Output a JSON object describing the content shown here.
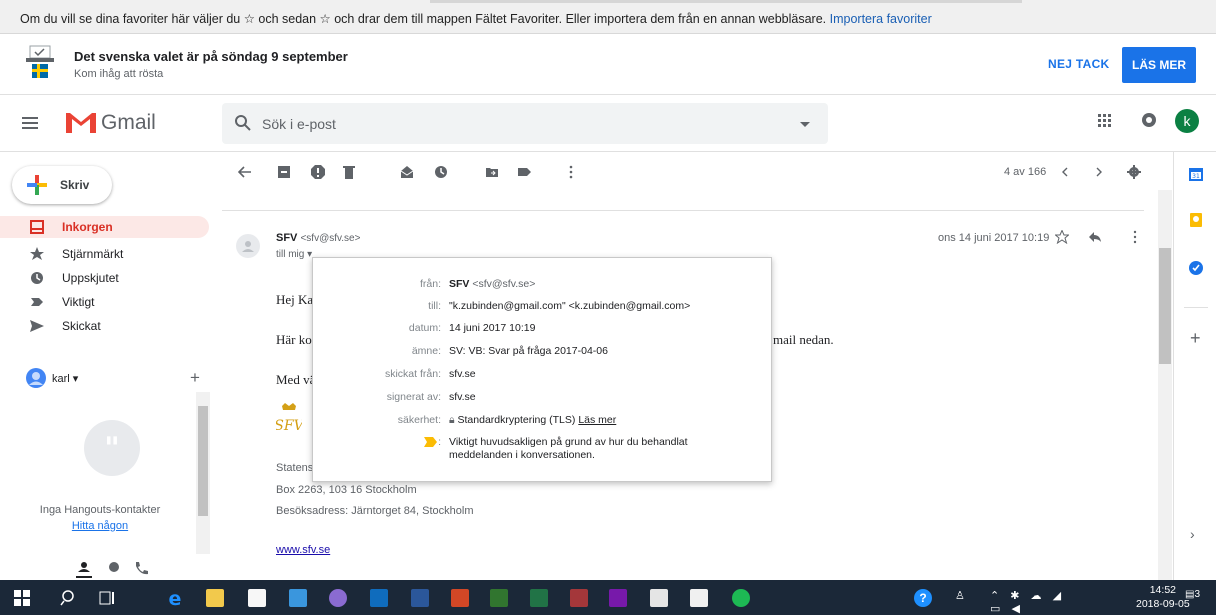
{
  "favorites_bar": {
    "message": "Om du vill se dina favoriter här väljer du ☆ och sedan ☆ och drar dem till mappen Fältet Favoriter. Eller importera dem från en annan webbläsare.",
    "import_link": "Importera favoriter"
  },
  "promo": {
    "title": "Det svenska valet är på söndag 9 september",
    "subtitle": "Kom ihåg att rösta",
    "dismiss_label": "NEJ TACK",
    "more_label": "LÄS MER"
  },
  "header": {
    "app_name": "Gmail",
    "search_placeholder": "Sök i e-post",
    "avatar_letter": "k"
  },
  "nav": {
    "compose_label": "Skriv",
    "items": [
      {
        "label": "Inkorgen",
        "icon": "inbox-icon",
        "active": true
      },
      {
        "label": "Stjärnmärkt",
        "icon": "star-icon",
        "active": false
      },
      {
        "label": "Uppskjutet",
        "icon": "clock-icon",
        "active": false
      },
      {
        "label": "Viktigt",
        "icon": "important-icon",
        "active": false
      },
      {
        "label": "Skickat",
        "icon": "send-icon",
        "active": false
      }
    ]
  },
  "hangouts": {
    "user_name": "karl",
    "no_contacts": "Inga Hangouts-kontakter",
    "find_link": "Hitta någon"
  },
  "toolbar": {
    "count": "4 av 166"
  },
  "message": {
    "sender_name": "SFV",
    "sender_email": "<sfv@sfv.se>",
    "to_line": "till mig",
    "date": "ons 14 juni 2017 10:19",
    "greeting": "Hej Ka",
    "body_start": "Här ko",
    "body_end": "mail nedan.",
    "closing": "Med vä",
    "sig_org": "Statens",
    "sig_box": "Box 2263, 103 16 Stockholm",
    "sig_visit": "Besöksadress: Järntorget 84, Stockholm",
    "sig_link": "www.sfv.se"
  },
  "details_popup": {
    "rows": {
      "from_label": "från:",
      "from_name": "SFV",
      "from_email": "<sfv@sfv.se>",
      "to_label": "till:",
      "to_value": "\"k.zubinden@gmail.com\" <k.zubinden@gmail.com>",
      "date_label": "datum:",
      "date_value": "14 juni 2017 10:19",
      "subject_label": "ämne:",
      "subject_value": "SV: VB: Svar på fråga 2017-04-06",
      "mailed_by_label": "skickat från:",
      "mailed_by_value": "sfv.se",
      "signed_by_label": "signerat av:",
      "signed_by_value": "sfv.se",
      "security_label": "säkerhet:",
      "security_value": "Standardkryptering (TLS)",
      "security_link": "Läs mer",
      "importance_text": "Viktigt huvudsakligen på grund av hur du behandlat meddelanden i konversationen."
    }
  },
  "taskbar": {
    "time": "14:52",
    "date": "2018-09-05",
    "notification_count": "3"
  },
  "colors": {
    "gmail_red": "#d93025",
    "accent_blue": "#1a73e8",
    "taskbar": "#1b2838"
  }
}
